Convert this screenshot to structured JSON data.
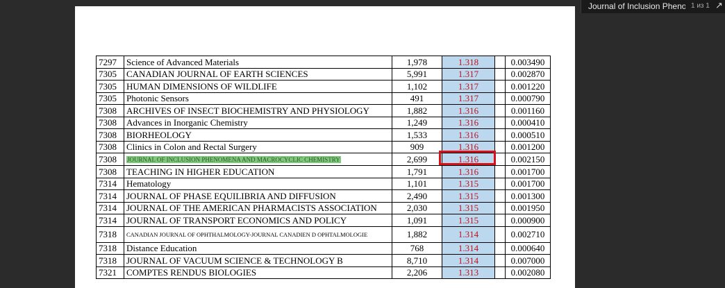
{
  "tab": {
    "title": "Journal of Inclusion Phenomena",
    "page_count": "1 из 1",
    "expand_icon": "↗"
  },
  "rows": [
    {
      "rank": "7297",
      "name": "Science of Advanced Materials",
      "cites": "1,978",
      "if": "1.318",
      "eig": "0.003490"
    },
    {
      "rank": "7305",
      "name": "CANADIAN JOURNAL OF EARTH SCIENCES",
      "cites": "5,991",
      "if": "1.317",
      "eig": "0.002870"
    },
    {
      "rank": "7305",
      "name": "HUMAN DIMENSIONS OF WILDLIFE",
      "cites": "1,102",
      "if": "1.317",
      "eig": "0.001220"
    },
    {
      "rank": "7305",
      "name": "Photonic Sensors",
      "cites": "491",
      "if": "1.317",
      "eig": "0.000790"
    },
    {
      "rank": "7308",
      "name": "ARCHIVES OF INSECT BIOCHEMISTRY AND PHYSIOLOGY",
      "cites": "1,882",
      "if": "1.316",
      "eig": "0.001160"
    },
    {
      "rank": "7308",
      "name": "Advances in Inorganic Chemistry",
      "cites": "1,249",
      "if": "1.316",
      "eig": "0.000410"
    },
    {
      "rank": "7308",
      "name": "BIORHEOLOGY",
      "cites": "1,533",
      "if": "1.316",
      "eig": "0.000510"
    },
    {
      "rank": "7308",
      "name": "Clinics in Colon and Rectal Surgery",
      "cites": "909",
      "if": "1.316",
      "eig": "0.001200"
    },
    {
      "rank": "7308",
      "name": "JOURNAL OF INCLUSION PHENOMENA AND MACROCYCLIC CHEMISTRY",
      "cites": "2,699",
      "if": "1.316",
      "eig": "0.002150"
    },
    {
      "rank": "7308",
      "name": "TEACHING IN HIGHER EDUCATION",
      "cites": "1,791",
      "if": "1.316",
      "eig": "0.001700"
    },
    {
      "rank": "7314",
      "name": "Hematology",
      "cites": "1,101",
      "if": "1.315",
      "eig": "0.001700"
    },
    {
      "rank": "7314",
      "name": "JOURNAL OF PHASE EQUILIBRIA AND DIFFUSION",
      "cites": "2,490",
      "if": "1.315",
      "eig": "0.001300"
    },
    {
      "rank": "7314",
      "name": "JOURNAL OF THE AMERICAN PHARMACISTS ASSOCIATION",
      "cites": "2,030",
      "if": "1.315",
      "eig": "0.001950"
    },
    {
      "rank": "7314",
      "name": "JOURNAL OF TRANSPORT ECONOMICS AND POLICY",
      "cites": "1,091",
      "if": "1.315",
      "eig": "0.000900"
    },
    {
      "rank": "7318",
      "name": "CANADIAN JOURNAL OF OPHTHALMOLOGY-JOURNAL CANADIEN D OPHTALMOLOGIE",
      "cites": "1,882",
      "if": "1.314",
      "eig": "0.002710"
    },
    {
      "rank": "7318",
      "name": "Distance Education",
      "cites": "768",
      "if": "1.314",
      "eig": "0.000640"
    },
    {
      "rank": "7318",
      "name": "JOURNAL OF VACUUM SCIENCE & TECHNOLOGY B",
      "cites": "8,710",
      "if": "1.314",
      "eig": "0.007000"
    },
    {
      "rank": "7321",
      "name": "COMPTES RENDUS BIOLOGIES",
      "cites": "2,206",
      "if": "1.313",
      "eig": "0.002080"
    }
  ],
  "highlight": {
    "highlighted_row": "JOURNAL OF INCLUSION PHENOMENA AND MACROCYCLIC CHEMISTRY",
    "highlight_color": "#7ec87e",
    "box_color": "#d8101a"
  }
}
